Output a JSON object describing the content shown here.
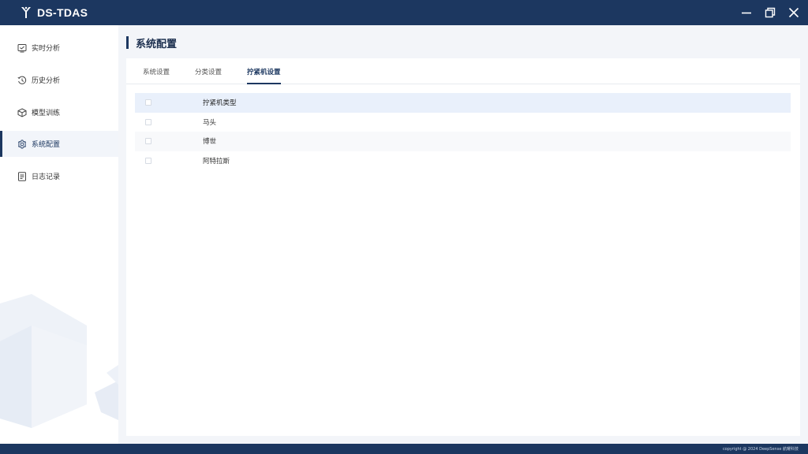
{
  "app": {
    "title": "DS-TDAS"
  },
  "window": {
    "minimize_icon": "minimize-icon",
    "restore_icon": "restore-icon",
    "close_icon": "close-icon"
  },
  "sidebar": {
    "items": [
      {
        "label": "实时分析",
        "icon": "monitor-check-icon",
        "active": false
      },
      {
        "label": "历史分析",
        "icon": "history-clock-icon",
        "active": false
      },
      {
        "label": "模型训练",
        "icon": "cube-icon",
        "active": false
      },
      {
        "label": "系统配置",
        "icon": "gear-icon",
        "active": true
      },
      {
        "label": "日志记录",
        "icon": "document-icon",
        "active": false
      }
    ]
  },
  "page": {
    "title": "系统配置"
  },
  "tabs": [
    {
      "label": "系统设置",
      "active": false
    },
    {
      "label": "分类设置",
      "active": false
    },
    {
      "label": "拧紧机设置",
      "active": true
    }
  ],
  "table": {
    "header": "拧紧机类型",
    "rows": [
      "马头",
      "博世",
      "阿特拉斯"
    ]
  },
  "footer": {
    "copyright": "copyright @ 2024 DeepSense 航耀科技"
  },
  "colors": {
    "primary": "#1c3760",
    "background": "#f3f5f9",
    "header_row": "#e9f0fb"
  }
}
